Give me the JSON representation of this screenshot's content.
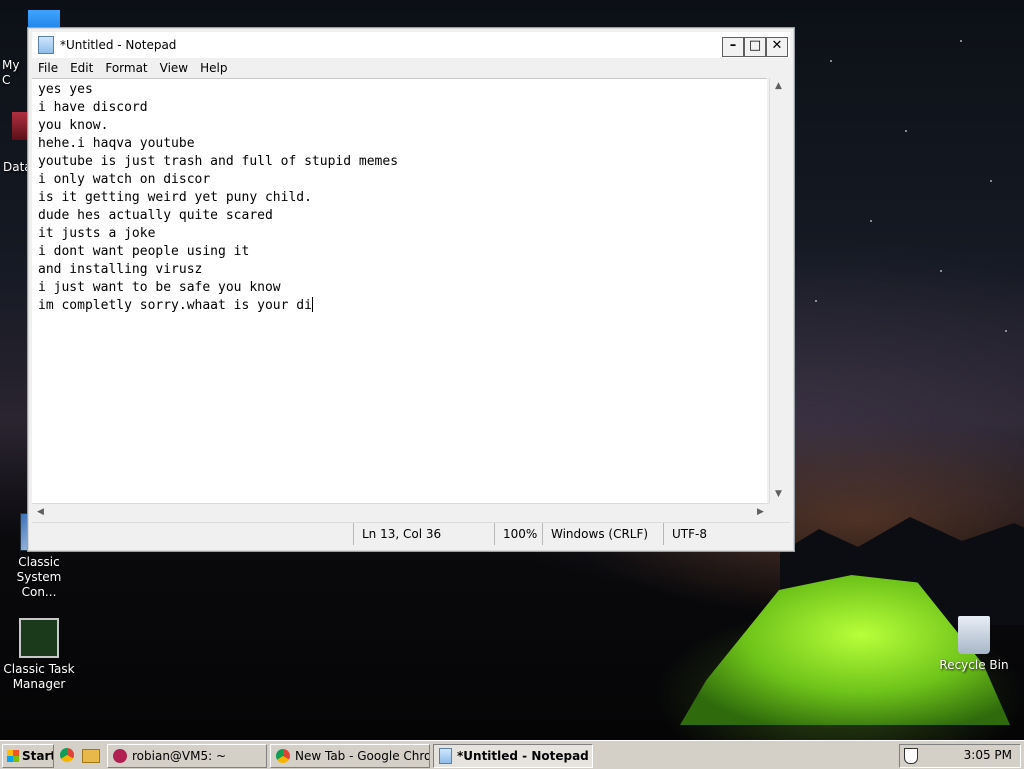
{
  "desktop": {
    "icons": [
      {
        "label": "My C",
        "icon": "computer-icon"
      },
      {
        "label": "Data",
        "icon": "database-icon"
      },
      {
        "label": "Classic System Con...",
        "icon": "control-panel-icon"
      },
      {
        "label": "Classic Task Manager",
        "icon": "task-manager-icon"
      },
      {
        "label": "Recycle Bin",
        "icon": "recycle-bin-icon"
      }
    ]
  },
  "notepad": {
    "title": "*Untitled - Notepad",
    "menu": [
      "File",
      "Edit",
      "Format",
      "View",
      "Help"
    ],
    "content": "yes yes\ni have discord\nyou know.\nhehe.i haqva youtube\nyoutube is just trash and full of stupid memes\ni only watch on discor\nis it getting weird yet puny child.\ndude hes actually quite scared\nit justs a joke\ni dont want people using it\nand installing virusz\ni just want to be safe you know\nim completly sorry.whaat is your di",
    "status": {
      "position": "Ln 13, Col 36",
      "zoom": "100%",
      "line_ending": "Windows (CRLF)",
      "encoding": "UTF-8"
    }
  },
  "taskbar": {
    "start_label": "Start",
    "tasks": [
      {
        "label": "robian@VM5: ~",
        "icon": "terminal-icon",
        "active": false
      },
      {
        "label": "New Tab - Google Chro...",
        "icon": "chrome-icon",
        "active": false
      },
      {
        "label": "*Untitled - Notepad",
        "icon": "notepad-icon",
        "active": true
      }
    ],
    "clock": "3:05 PM"
  },
  "colors": {
    "taskbar": "#d4d0c8",
    "tent": "#8fe22a"
  }
}
